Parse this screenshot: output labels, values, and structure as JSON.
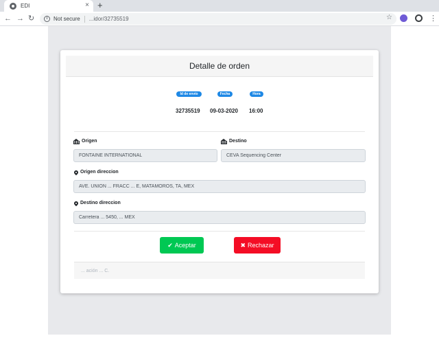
{
  "browser": {
    "tab_title": "EDI",
    "tab_close": "×",
    "new_tab": "+",
    "security_label": "Not secure",
    "url": "...idor/32735519",
    "back": "←",
    "forward": "→",
    "reload": "↻",
    "star": "☆",
    "menu": "⋮"
  },
  "card": {
    "title": "Detalle de orden",
    "summary": {
      "labels": [
        "Id de envío",
        "Fecha",
        "Hora"
      ],
      "values": [
        "32735519",
        "09-03-2020",
        "16:00"
      ]
    },
    "origen": {
      "label": "Origen",
      "value": "FONTAINE INTERNATIONAL"
    },
    "destino": {
      "label": "Destino",
      "value": "CEVA Sequencing Center"
    },
    "origen_direccion": {
      "label": "Origen direccion",
      "value": "AVE. UNION ... FRACC ... E, MATAMOROS, TA, MEX"
    },
    "destino_direccion": {
      "label": "Destino direccion",
      "value": "Carretera ... 5450, ... MEX"
    },
    "accept_label": "Aceptar",
    "reject_label": "Rechazar",
    "footer_text": "... ación ... C."
  },
  "colors": {
    "accept": "#00c853",
    "reject": "#f40d25",
    "badge": "#1e88e5"
  }
}
